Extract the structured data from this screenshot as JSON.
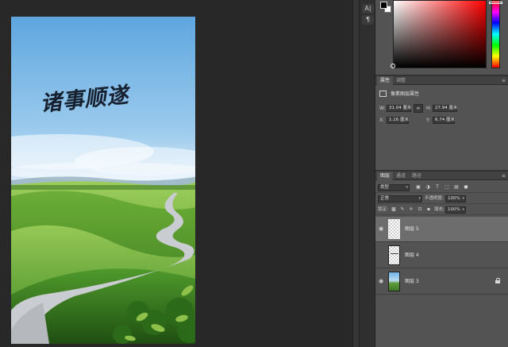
{
  "canvas": {
    "calligraphy_text": "诸事顺遂"
  },
  "mini_toolbar": {
    "items": [
      {
        "icon": "character-icon",
        "label": "A|"
      },
      {
        "icon": "paragraph-icon",
        "label": "¶"
      }
    ]
  },
  "color_panel": {
    "foreground_color": "#000000",
    "background_color": "#ffffff",
    "hue_color": "#ff0000"
  },
  "properties_panel": {
    "tabs": [
      {
        "label": "属性",
        "active": true
      },
      {
        "label": "调整",
        "active": false
      }
    ],
    "kind_label": "像素图层属性",
    "w_label": "W:",
    "w_value": "31.04 厘米",
    "h_label": "H:",
    "h_value": "27.94 厘米",
    "x_label": "X:",
    "x_value": "1.16 厘米",
    "y_label": "Y:",
    "y_value": "6.74 厘米",
    "link_icon": "link-icon"
  },
  "layers_panel": {
    "tabs": [
      {
        "label": "图层",
        "active": true
      },
      {
        "label": "通道",
        "active": false
      },
      {
        "label": "路径",
        "active": false
      }
    ],
    "filter_kind": "类型",
    "blend_mode": "正常",
    "opacity_label": "不透明度:",
    "opacity_value": "100%",
    "lock_label": "锁定:",
    "fill_label": "填充:",
    "fill_value": "100%",
    "layers": [
      {
        "name": "图层 5",
        "visible": true,
        "selected": true,
        "locked": false,
        "thumb": "transparent"
      },
      {
        "name": "图层 4",
        "visible": false,
        "selected": false,
        "locked": false,
        "thumb": "transparent-text"
      },
      {
        "name": "图层 3",
        "visible": true,
        "selected": false,
        "locked": true,
        "thumb": "photo"
      }
    ]
  }
}
